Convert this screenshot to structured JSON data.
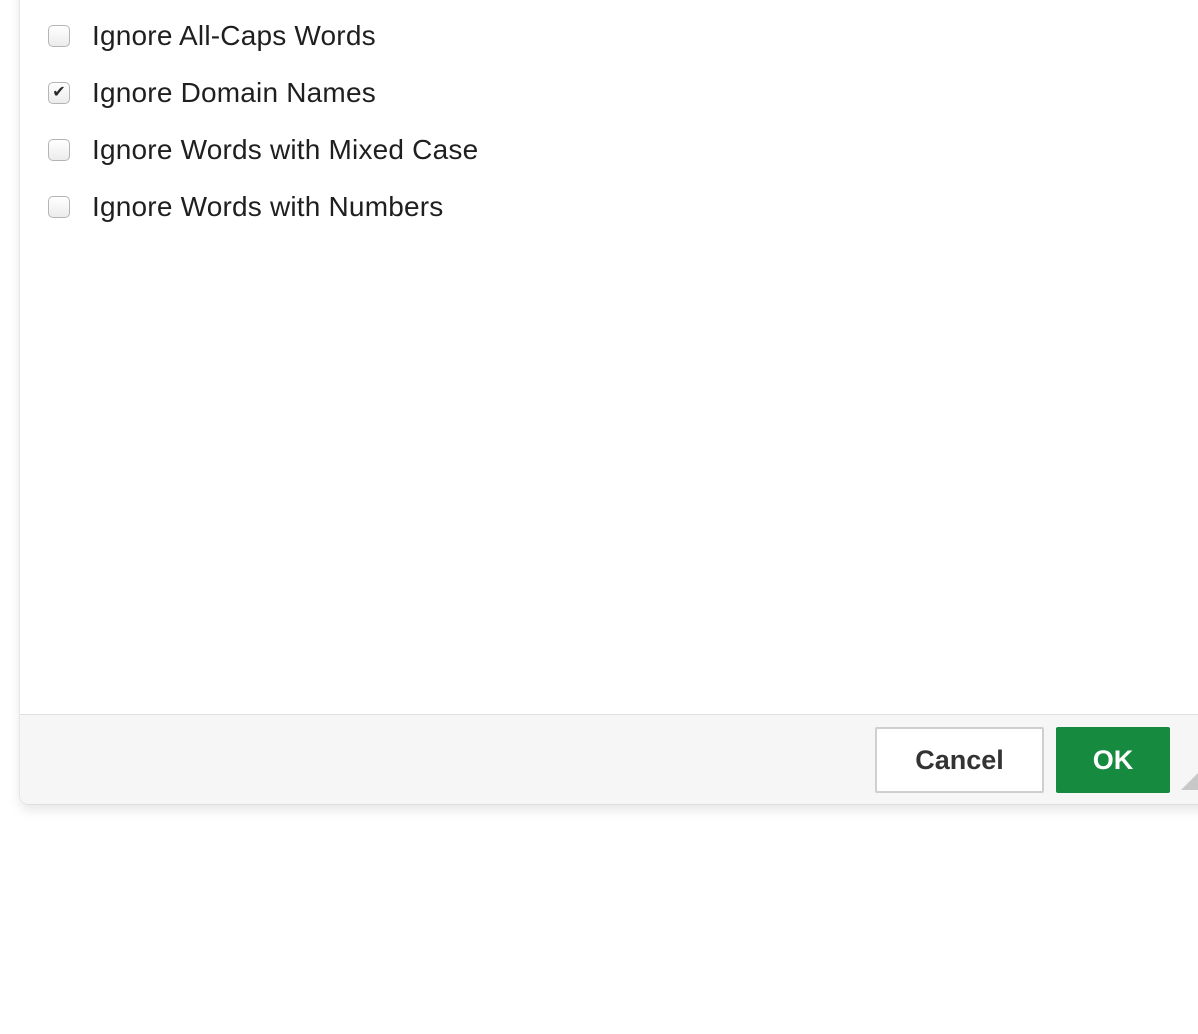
{
  "options": [
    {
      "label": "Ignore All-Caps Words",
      "checked": false
    },
    {
      "label": "Ignore Domain Names",
      "checked": true
    },
    {
      "label": "Ignore Words with Mixed Case",
      "checked": false
    },
    {
      "label": "Ignore Words with Numbers",
      "checked": false
    }
  ],
  "footer": {
    "cancel_label": "Cancel",
    "ok_label": "OK"
  },
  "colors": {
    "ok_background": "#168b3f",
    "footer_background": "#f6f6f6"
  },
  "icons": {
    "check": "checkmark-icon",
    "resize": "resize-grip-icon"
  }
}
